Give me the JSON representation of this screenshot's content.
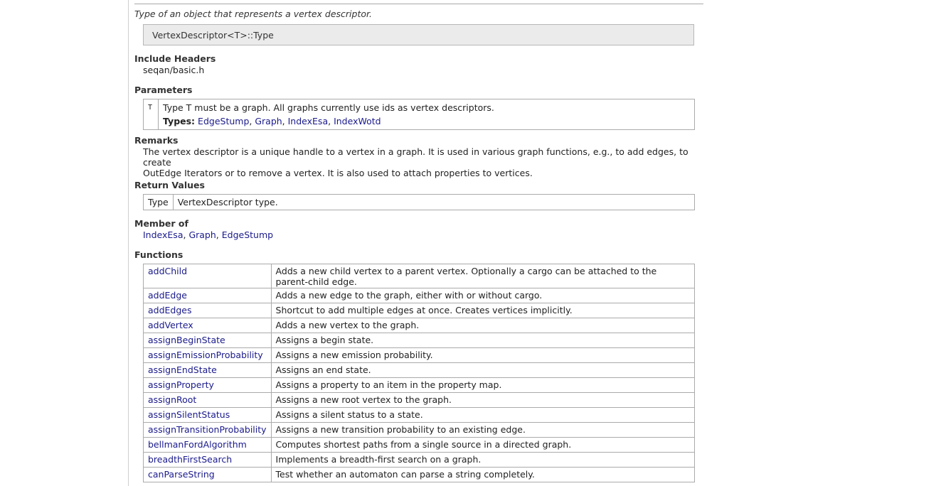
{
  "summary": "Type of an object that represents a vertex descriptor.",
  "signature": "VertexDescriptor<T>::Type",
  "include_headers": {
    "title": "Include Headers",
    "value": "seqan/basic.h"
  },
  "parameters": {
    "title": "Parameters",
    "key": "T",
    "description": "Type T must be a graph. All graphs currently use ids as vertex descriptors.",
    "types_label": "Types:",
    "types": [
      "EdgeStump",
      "Graph",
      "IndexEsa",
      "IndexWotd"
    ]
  },
  "remarks": {
    "title": "Remarks",
    "line1": "The vertex descriptor is a unique handle to a vertex in a graph. It is used in various graph functions, e.g., to add edges, to create",
    "line2": "OutEdge Iterators or to remove a vertex. It is also used to attach properties to vertices."
  },
  "return_values": {
    "title": "Return Values",
    "key": "Type",
    "value": "VertexDescriptor type."
  },
  "member_of": {
    "title": "Member of",
    "items": [
      "IndexEsa",
      "Graph",
      "EdgeStump"
    ]
  },
  "functions": {
    "title": "Functions",
    "rows": [
      {
        "name": "addChild",
        "desc": "Adds a new child vertex to a parent vertex. Optionally a cargo can be attached to the parent-child edge."
      },
      {
        "name": "addEdge",
        "desc": "Adds a new edge to the graph, either with or without cargo."
      },
      {
        "name": "addEdges",
        "desc": "Shortcut to add multiple edges at once. Creates vertices implicitly."
      },
      {
        "name": "addVertex",
        "desc": "Adds a new vertex to the graph."
      },
      {
        "name": "assignBeginState",
        "desc": "Assigns a begin state."
      },
      {
        "name": "assignEmissionProbability",
        "desc": "Assigns a new emission probability."
      },
      {
        "name": "assignEndState",
        "desc": "Assigns an end state."
      },
      {
        "name": "assignProperty",
        "desc": "Assigns a property to an item in the property map."
      },
      {
        "name": "assignRoot",
        "desc": "Assigns a new root vertex to the graph."
      },
      {
        "name": "assignSilentStatus",
        "desc": "Assigns a silent status to a state."
      },
      {
        "name": "assignTransitionProbability",
        "desc": "Assigns a new transition probability to an existing edge."
      },
      {
        "name": "bellmanFordAlgorithm",
        "desc": "Computes shortest paths from a single source in a directed graph."
      },
      {
        "name": "breadthFirstSearch",
        "desc": "Implements a breadth-first search on a graph."
      },
      {
        "name": "canParseString",
        "desc": "Test whether an automaton can parse a string completely."
      }
    ]
  }
}
